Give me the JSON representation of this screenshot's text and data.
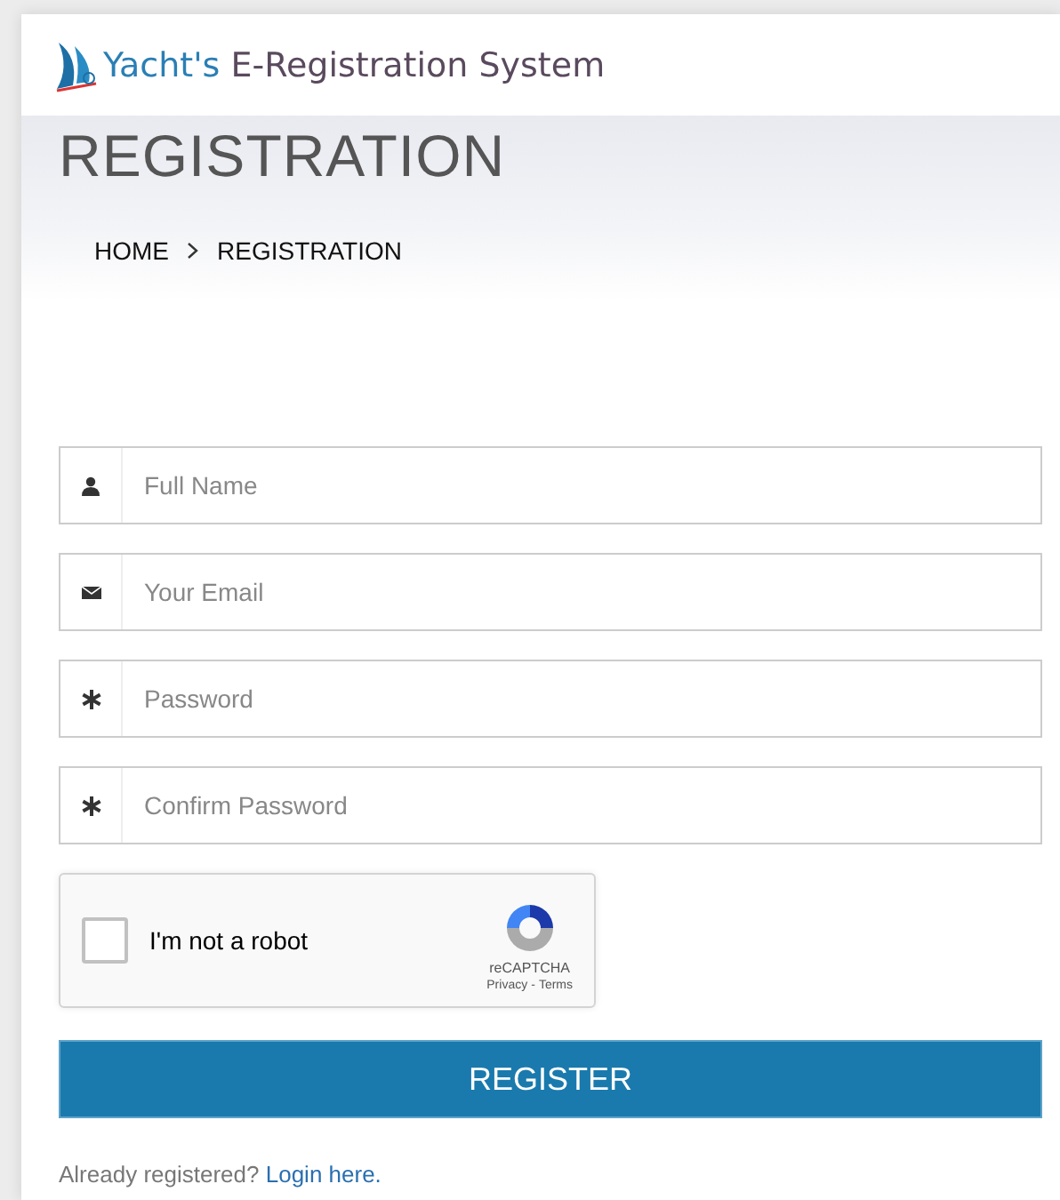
{
  "header": {
    "brand_first": "Yacht's",
    "brand_rest": "E-Registration System"
  },
  "banner": {
    "title": "REGISTRATION",
    "breadcrumb": [
      "HOME",
      "REGISTRATION"
    ]
  },
  "fields": [
    {
      "kind": "person",
      "placeholder": "Full Name"
    },
    {
      "kind": "envelope",
      "placeholder": "Your Email"
    },
    {
      "kind": "asterisk",
      "placeholder": "Password"
    },
    {
      "kind": "asterisk",
      "placeholder": "Confirm Password"
    }
  ],
  "captcha": {
    "checked": false,
    "label": "I'm not a robot",
    "brand": "reCAPTCHA",
    "privacy": "Privacy",
    "separator": "-",
    "terms": "Terms"
  },
  "submit": "REGISTER",
  "footer": {
    "text": "Already registered?",
    "link": "Login here."
  }
}
